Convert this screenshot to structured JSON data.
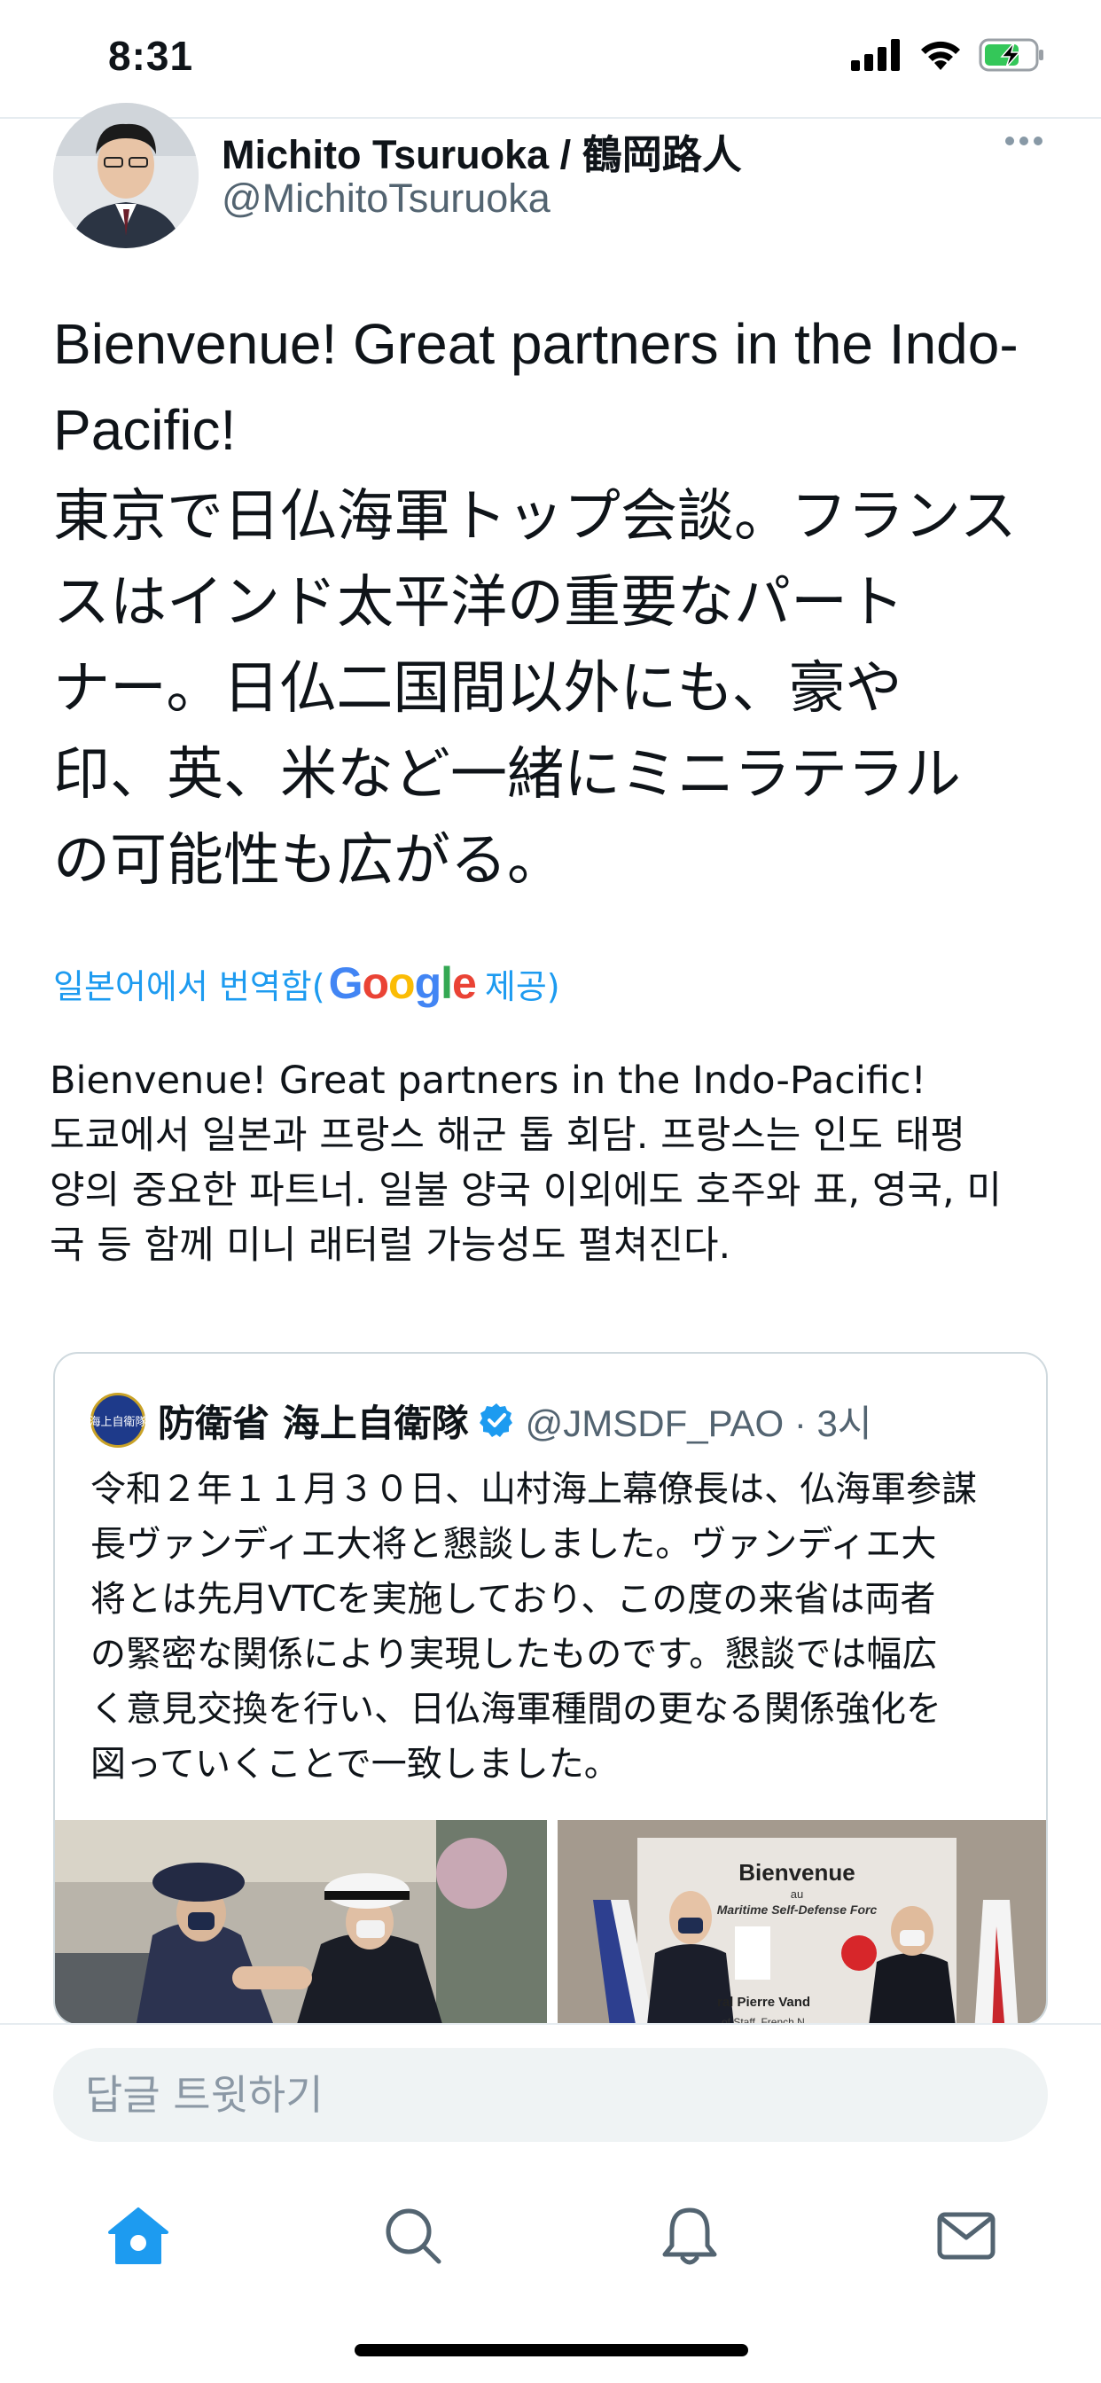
{
  "status_bar": {
    "time": "8:31"
  },
  "author": {
    "name": "Michito Tsuruoka / 鶴岡路人",
    "handle": "@MichitoTsuruoka"
  },
  "tweet": {
    "lines": [
      "Bienvenue! Great partners in the Indo-",
      "Pacific!",
      "東京で日仏海軍トップ会談。フランス",
      "スはインド太平洋の重要なパート",
      "ナー。日仏二国間以外にも、豪や",
      "印、英、米など一緒にミニラテラル",
      "の可能性も広がる。"
    ]
  },
  "translation": {
    "prefix": "일본어에서 번역함(",
    "provider": "Google",
    "suffix": " 제공)",
    "lines": [
      "Bienvenue! Great partners in the Indo-Pacific!",
      " 도쿄에서 일본과 프랑스 해군 톱 회담. 프랑스는 인도 태평",
      "양의 중요한 파트너. 일불 양국 이외에도 호주와 표, 영국, 미",
      "국 등 함께 미니 래터럴 가능성도 펼쳐진다."
    ]
  },
  "quoted_tweet": {
    "name": "防衛省 海上自衛隊",
    "handle": "@JMSDF_PAO · 3시",
    "avatar_text": "海上自衛隊",
    "lines": [
      "令和２年１１月３０日、山村海上幕僚長は、仏海軍参謀",
      "長ヴァンディエ大将と懇談しました。ヴァンディエ大",
      "将とは先月VTCを実施しており、この度の来省は両者",
      "の緊密な関係により実現したものです。懇談では幅広",
      "く意見交換を行い、日仏海軍種間の更なる関係強化を",
      "図っていくことで一致しました。"
    ],
    "image_right": {
      "banner_title": "Bienvenue",
      "banner_small": "au",
      "banner_line": "Maritime Self-Defense Forc",
      "caption1": "ral Pierre Vand",
      "caption2": "of Staff, French N"
    }
  },
  "reply": {
    "placeholder": "답글 트윗하기"
  },
  "tabs": [
    "home-icon",
    "search-icon",
    "notifications-icon",
    "messages-icon"
  ],
  "colors": {
    "accent": "#1d9bf0",
    "verified": "#1d9bf0"
  }
}
